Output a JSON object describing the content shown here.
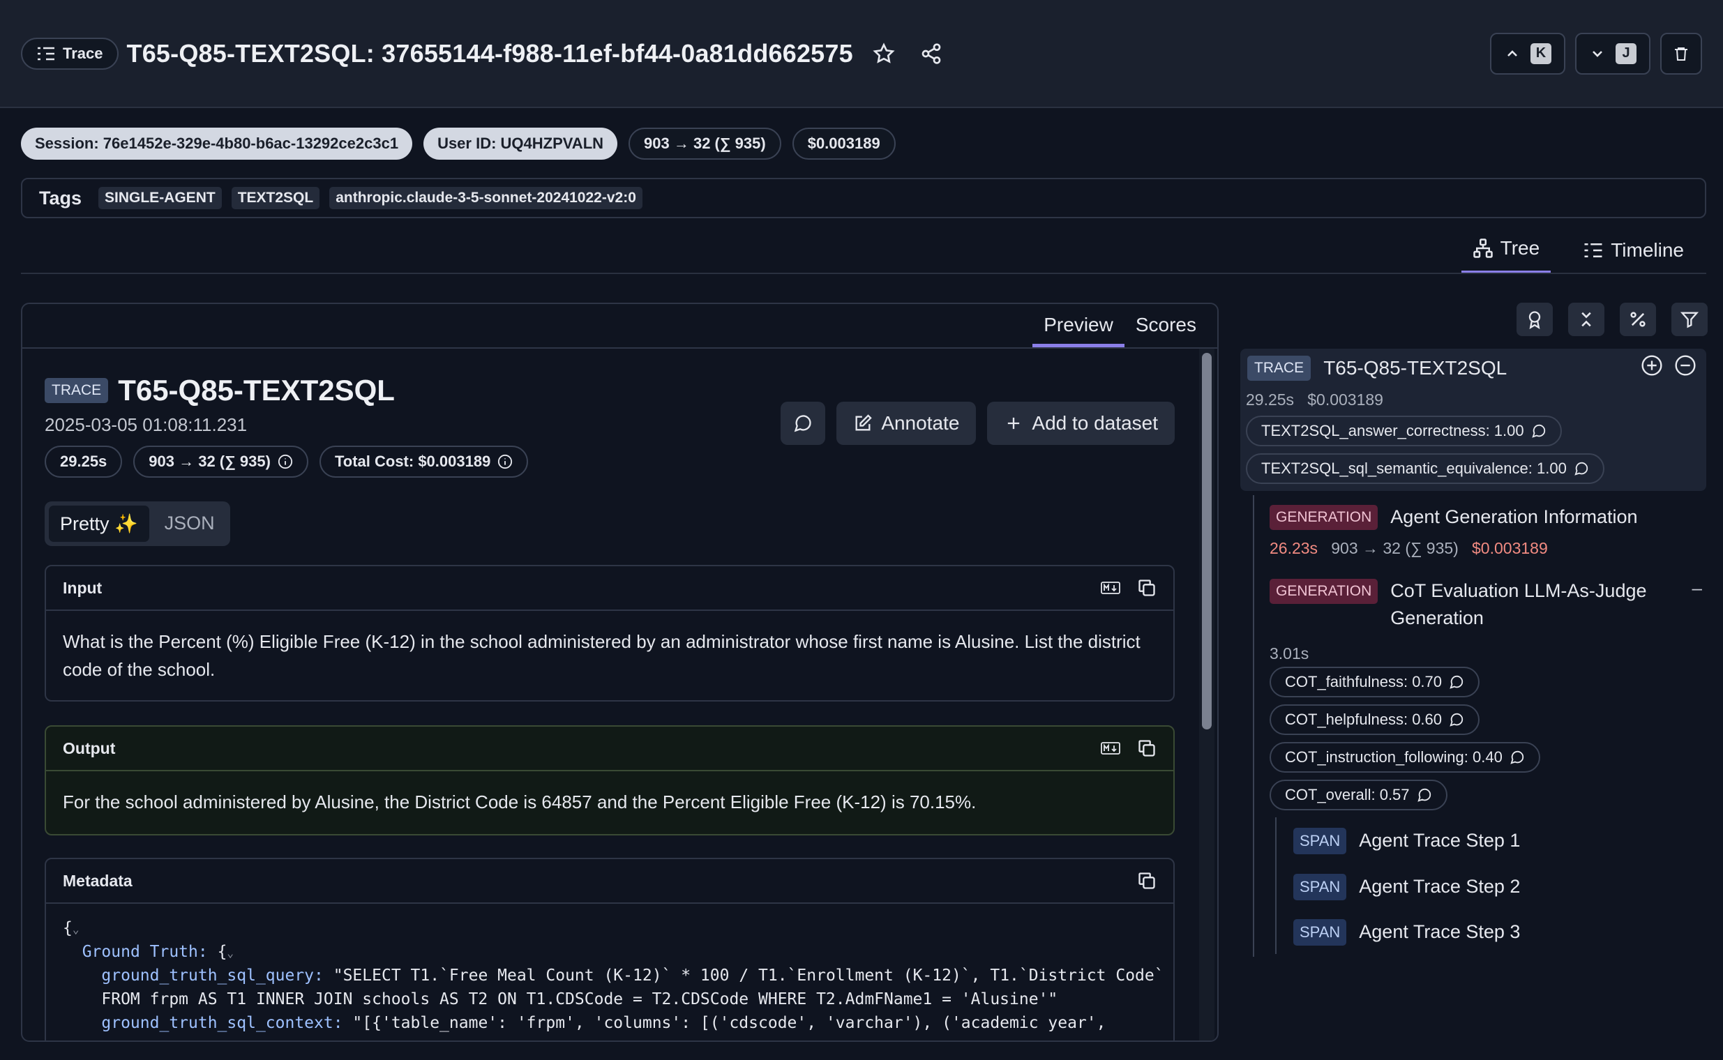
{
  "header": {
    "trace_pill_label": "Trace",
    "title": "T65-Q85-TEXT2SQL: 37655144-f988-11ef-bf44-0a81dd662575",
    "prev_key": "K",
    "next_key": "J"
  },
  "chips": {
    "session": "Session: 76e1452e-329e-4b80-b6ac-13292ce2c3c1",
    "user": "User ID: UQ4HZPVALN",
    "tokens": "903 → 32 (∑ 935)",
    "cost": "$0.003189"
  },
  "tags": {
    "label": "Tags",
    "items": [
      "SINGLE-AGENT",
      "TEXT2SQL",
      "anthropic.claude-3-5-sonnet-20241022-v2:0"
    ]
  },
  "view_tabs": {
    "tree": "Tree",
    "timeline": "Timeline"
  },
  "panel": {
    "tabs": {
      "preview": "Preview",
      "scores": "Scores"
    },
    "badge": "TRACE",
    "name": "T65-Q85-TEXT2SQL",
    "timestamp": "2025-03-05 01:08:11.231",
    "stats": {
      "latency": "29.25s",
      "tokens": "903 → 32 (∑ 935)",
      "total_cost": "Total Cost: $0.003189"
    },
    "actions": {
      "annotate": "Annotate",
      "add_to_dataset": "Add to dataset"
    },
    "toggle": {
      "pretty": "Pretty",
      "json": "JSON"
    },
    "input": {
      "label": "Input",
      "text": "What is the Percent (%) Eligible Free (K-12) in the school administered by an administrator whose first name is Alusine. List the district code of the school."
    },
    "output": {
      "label": "Output",
      "text": "For the school administered by Alusine, the District Code is 64857 and the Percent Eligible Free (K-12) is 70.15%."
    },
    "metadata": {
      "label": "Metadata",
      "line1": "{",
      "line2_key": "Ground Truth:",
      "line2_val": " {",
      "line3_key": "ground_truth_sql_query:",
      "line3_val": " \"SELECT T1.`Free Meal Count (K-12)` * 100 / T1.`Enrollment (K-12)`, T1.`District Code`",
      "line4": "FROM frpm AS T1 INNER JOIN schools AS T2 ON T1.CDSCode = T2.CDSCode WHERE T2.AdmFName1 = 'Alusine'\"",
      "line5_key": "ground_truth_sql_context:",
      "line5_val": " \"[{'table_name': 'frpm', 'columns': [('cdscode', 'varchar'), ('academic year',"
    }
  },
  "tree": {
    "root": {
      "badge": "TRACE",
      "name": "T65-Q85-TEXT2SQL",
      "latency": "29.25s",
      "cost": "$0.003189",
      "scores": [
        "TEXT2SQL_answer_correctness: 1.00",
        "TEXT2SQL_sql_semantic_equivalence: 1.00"
      ]
    },
    "gen1": {
      "badge": "GENERATION",
      "name": "Agent Generation Information",
      "latency": "26.23s",
      "tokens": "903 → 32 (∑ 935)",
      "cost": "$0.003189"
    },
    "gen2": {
      "badge": "GENERATION",
      "name_line1": "CoT Evaluation LLM-As-Judge",
      "name_line2": "Generation",
      "latency": "3.01s",
      "collapse": "–",
      "scores": [
        "COT_faithfulness: 0.70",
        "COT_helpfulness: 0.60",
        "COT_instruction_following: 0.40",
        "COT_overall: 0.57"
      ]
    },
    "spans": [
      {
        "badge": "SPAN",
        "name": "Agent Trace Step 1"
      },
      {
        "badge": "SPAN",
        "name": "Agent Trace Step 2"
      },
      {
        "badge": "SPAN",
        "name": "Agent Trace Step 3"
      }
    ]
  },
  "colors": {
    "accent": "#8b7fe8",
    "generation_badge": "#5a2038",
    "span_badge": "#23355a",
    "latency_warn": "#f28b82"
  }
}
